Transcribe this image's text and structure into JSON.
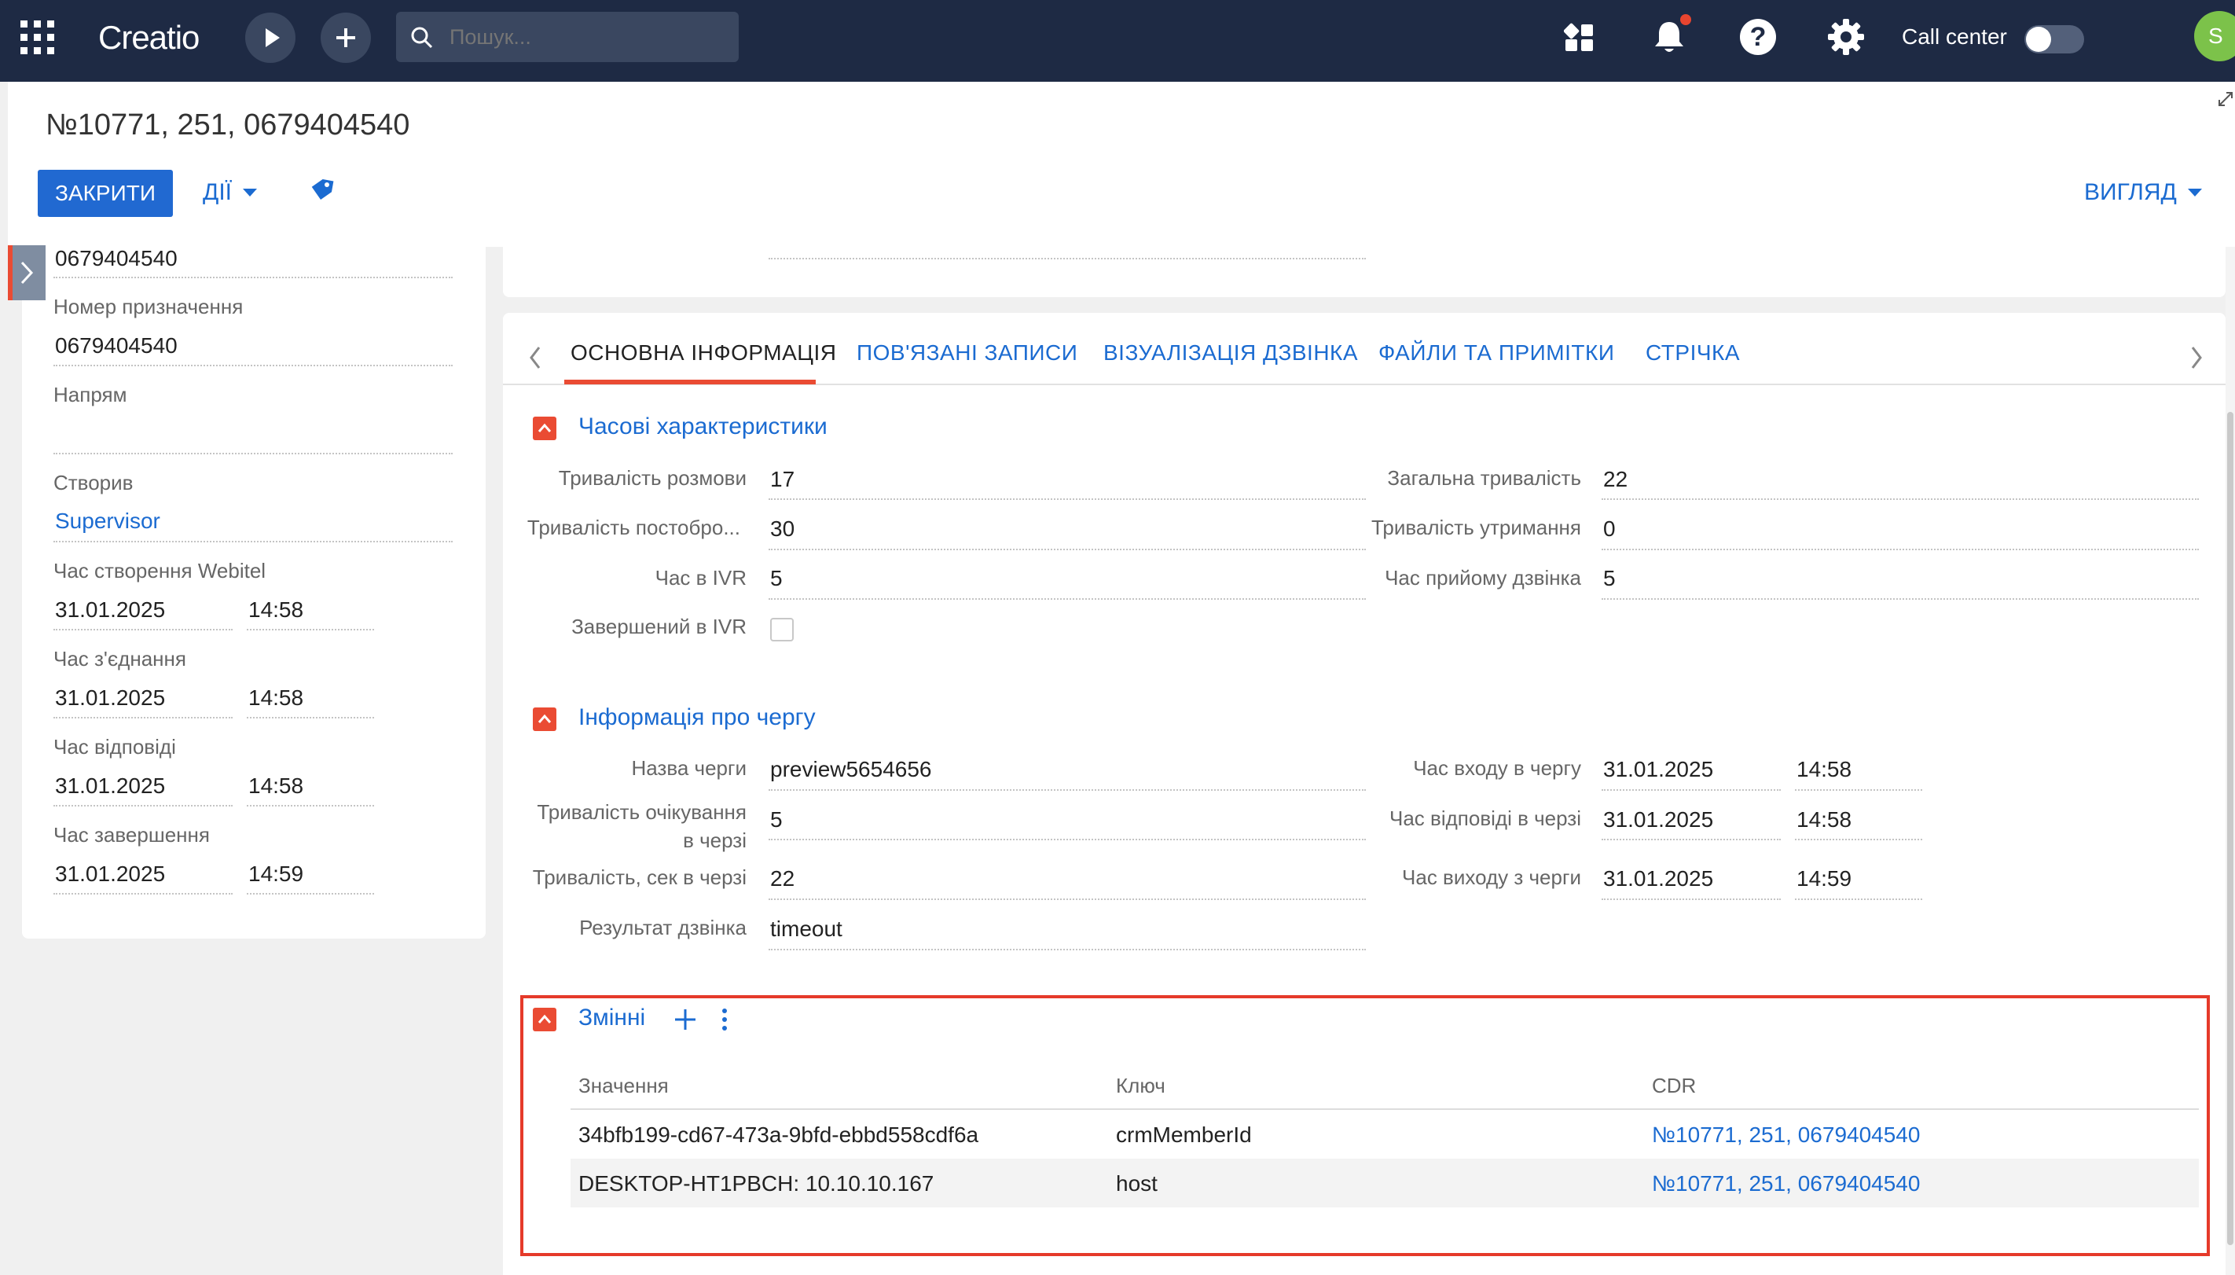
{
  "topbar": {
    "brand": "Creatio",
    "search_placeholder": "Пошук...",
    "call_center_label": "Call center",
    "avatar_letter": "S"
  },
  "page": {
    "title": "№10771, 251, 0679404540",
    "close_button": "ЗАКРИТИ",
    "actions_button": "ДІЇ",
    "view_button": "ВИГЛЯД"
  },
  "left_panel": {
    "caller_number": "0679404540",
    "dest_label": "Номер призначення",
    "dest_value": "0679404540",
    "direction_label": "Напрям",
    "direction_value": "",
    "created_by_label": "Створив",
    "created_by_value": "Supervisor",
    "webitel_created_label": "Час створення Webitel",
    "webitel_created_date": "31.01.2025",
    "webitel_created_time": "14:58",
    "connect_label": "Час з'єднання",
    "connect_date": "31.01.2025",
    "connect_time": "14:58",
    "answer_label": "Час відповіді",
    "answer_date": "31.01.2025",
    "answer_time": "14:58",
    "end_label": "Час завершення",
    "end_date": "31.01.2025",
    "end_time": "14:59"
  },
  "tabs": [
    "ОСНОВНА ІНФОРМАЦІЯ",
    "ПОВ'ЯЗАНІ ЗАПИСИ",
    "ВІЗУАЛІЗАЦІЯ ДЗВІНКА",
    "ФАЙЛИ ТА ПРИМІТКИ",
    "СТРІЧКА"
  ],
  "time_section": {
    "title": "Часові характеристики",
    "talk_label": "Тривалість розмови",
    "talk_value": "17",
    "post_label": "Тривалість постобро...",
    "post_value": "30",
    "ivr_label": "Час в IVR",
    "ivr_value": "5",
    "ivr_done_label": "Завершений в IVR",
    "ivr_done_checked": false,
    "total_label": "Загальна тривалість",
    "total_value": "22",
    "hold_label": "Тривалість утримання",
    "hold_value": "0",
    "receive_label": "Час прийому дзвінка",
    "receive_value": "5"
  },
  "queue_section": {
    "title": "Інформація про чергу",
    "name_label": "Назва черги",
    "name_value": "preview5654656",
    "wait_label_1": "Тривалість очікування",
    "wait_label_2": "в черзі",
    "wait_value": "5",
    "sec_label": "Тривалість, сек в черзі",
    "sec_value": "22",
    "result_label": "Результат дзвінка",
    "result_value": "timeout",
    "enter_label": "Час входу в чергу",
    "enter_date": "31.01.2025",
    "enter_time": "14:58",
    "answer_label": "Час відповіді в черзі",
    "answer_date": "31.01.2025",
    "answer_time": "14:58",
    "exit_label": "Час виходу з черги",
    "exit_date": "31.01.2025",
    "exit_time": "14:59"
  },
  "variables_section": {
    "title": "Змінні",
    "columns": {
      "value": "Значення",
      "key": "Ключ",
      "cdr": "CDR"
    },
    "rows": [
      {
        "value": "34bfb199-cd67-473a-9bfd-ebbd558cdf6a",
        "key": "crmMemberId",
        "cdr": "№10771, 251, 0679404540"
      },
      {
        "value": "DESKTOP-HT1PBCH: 10.10.10.167",
        "key": "host",
        "cdr": "№10771, 251, 0679404540"
      }
    ]
  },
  "colors": {
    "topbar": "#1e2a44",
    "accent": "#1b6bd1",
    "primary_button": "#2169d1",
    "section_toggle": "#ea4b33",
    "highlight_border": "#e53a2a",
    "avatar": "#7cc24a"
  }
}
